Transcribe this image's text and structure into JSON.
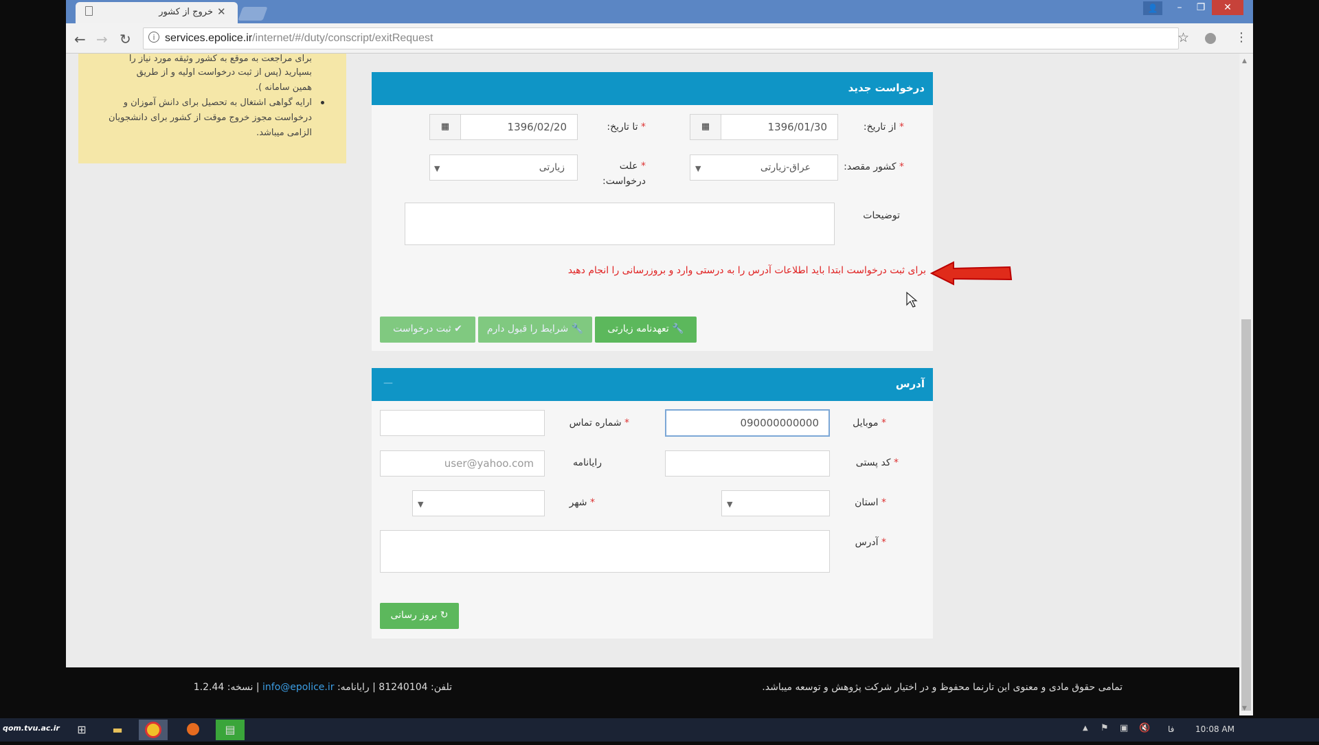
{
  "browser": {
    "tab_title": "خروج از کشور",
    "url_host": "services.epolice.ir",
    "url_path": "/internet/#/duty/conscript/exitRequest"
  },
  "notice": {
    "lines": [
      "برای مراجعت به موقع به کشور وثیقه مورد نیاز را",
      "بسپارید (پس از ثبت درخواست اولیه و از طریق",
      "همین سامانه ).",
      "ارایه گواهی اشتغال به تحصیل برای دانش آموزان و",
      "درخواست مجوز خروج موقت از کشور برای دانشجویان",
      "الزامی میباشد."
    ]
  },
  "request_panel": {
    "title": "درخواست جدید",
    "from_date_label": "از تاریخ:",
    "from_date_value": "1396/01/30",
    "to_date_label": "تا تاریخ:",
    "to_date_value": "1396/02/20",
    "dest_country_label": "کشور مقصد:",
    "dest_country_value": "عراق-زیارتی",
    "reason_label_1": "علت",
    "reason_label_2": "درخواست:",
    "reason_value": "زیارتی",
    "description_label": "توضیحات",
    "warning": "برای ثبت درخواست ابتدا باید اطلاعات آدرس را به درستی وارد و بروزرسانی را انجام دهید",
    "btn_pledge": "تعهدنامه زیارتی",
    "btn_accept": "شرایط را قبول دارم",
    "btn_submit": "ثبت درخواست"
  },
  "address_panel": {
    "title": "آدرس",
    "collapse": "—",
    "mobile_label": "موبایل",
    "mobile_value": "090000000000",
    "phone_label": "شماره تماس",
    "phone_value": "",
    "postal_label": "کد پستی",
    "postal_value": "",
    "email_label": "رایانامه",
    "email_placeholder": "user@yahoo.com",
    "province_label": "استان",
    "city_label": "شهر",
    "address_label": "آدرس",
    "btn_update": "بروز رسانی"
  },
  "footer": {
    "copyright": "تمامی حقوق مادی و معنوی این تارنما محفوظ و در اختیار شرکت پژوهش و توسعه میباشد.",
    "phone_part": "تلفن: 81240104 | رایانامه:",
    "email": "info@epolice.ir",
    "version_part": "| نسخه: 1.2.44"
  },
  "taskbar": {
    "watermark": "qom.tvu.ac.ir",
    "language": "فا",
    "time": "10:08 AM"
  },
  "colors": {
    "panel_header": "#0f95c6",
    "button_green": "#5cb85c",
    "warning_red": "#e02222",
    "notice_bg": "#f5e7a8"
  }
}
